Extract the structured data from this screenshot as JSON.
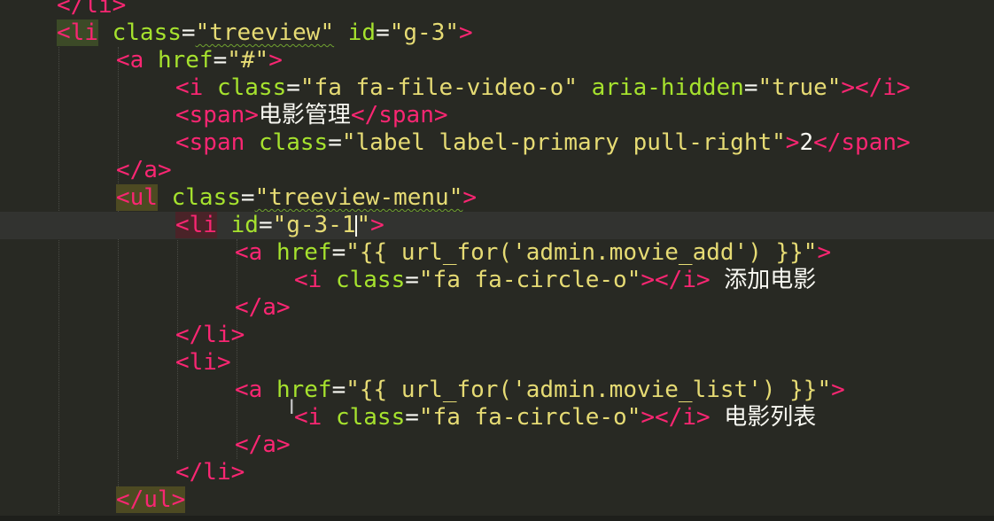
{
  "editor": {
    "lines": [
      {
        "id": "l0",
        "indent": 1,
        "parts": [
          [
            "tag",
            "</li>"
          ]
        ]
      },
      {
        "id": "l1",
        "indent": 1,
        "parts": [
          [
            "tag",
            "<li"
          ],
          [
            "punc",
            " "
          ],
          [
            "attr",
            "class"
          ],
          [
            "punc",
            "="
          ],
          [
            "str",
            "\"treeview\""
          ],
          [
            "punc",
            " "
          ],
          [
            "attr",
            "id"
          ],
          [
            "punc",
            "="
          ],
          [
            "str",
            "\"g-3\""
          ],
          [
            "tag",
            ">"
          ]
        ]
      },
      {
        "id": "l2",
        "indent": 2,
        "parts": [
          [
            "tag",
            "<a"
          ],
          [
            "punc",
            " "
          ],
          [
            "attr",
            "href"
          ],
          [
            "punc",
            "="
          ],
          [
            "str",
            "\"#\""
          ],
          [
            "tag",
            ">"
          ]
        ]
      },
      {
        "id": "l3",
        "indent": 3,
        "parts": [
          [
            "tag",
            "<i"
          ],
          [
            "punc",
            " "
          ],
          [
            "attr",
            "class"
          ],
          [
            "punc",
            "="
          ],
          [
            "str",
            "\"fa fa-file-video-o\""
          ],
          [
            "punc",
            " "
          ],
          [
            "attr",
            "aria-hidden"
          ],
          [
            "punc",
            "="
          ],
          [
            "str",
            "\"true\""
          ],
          [
            "tag",
            "></i>"
          ]
        ]
      },
      {
        "id": "l4",
        "indent": 3,
        "parts": [
          [
            "tag",
            "<span>"
          ],
          [
            "text",
            "电影管理"
          ],
          [
            "tag",
            "</span>"
          ]
        ]
      },
      {
        "id": "l5",
        "indent": 3,
        "parts": [
          [
            "tag",
            "<span"
          ],
          [
            "punc",
            " "
          ],
          [
            "attr",
            "class"
          ],
          [
            "punc",
            "="
          ],
          [
            "str",
            "\"label label-primary pull-right\""
          ],
          [
            "tag",
            ">"
          ],
          [
            "text",
            "2"
          ],
          [
            "tag",
            "</span>"
          ]
        ]
      },
      {
        "id": "l6",
        "indent": 2,
        "parts": [
          [
            "tag",
            "</a>"
          ]
        ]
      },
      {
        "id": "l7",
        "indent": 2,
        "parts": [
          [
            "tag",
            "<ul"
          ],
          [
            "punc",
            " "
          ],
          [
            "attr",
            "class"
          ],
          [
            "punc",
            "="
          ],
          [
            "str",
            "\"treeview-menu\""
          ],
          [
            "tag",
            ">"
          ]
        ]
      },
      {
        "id": "l8",
        "indent": 3,
        "parts": [
          [
            "tag",
            "<li"
          ],
          [
            "punc",
            " "
          ],
          [
            "attr",
            "id"
          ],
          [
            "punc",
            "="
          ],
          [
            "str",
            "\"g-3-1"
          ],
          [
            "caret",
            ""
          ],
          [
            "str",
            "\""
          ],
          [
            "tag",
            ">"
          ]
        ]
      },
      {
        "id": "l9",
        "indent": 4,
        "parts": [
          [
            "tag",
            "<a"
          ],
          [
            "punc",
            " "
          ],
          [
            "attr",
            "href"
          ],
          [
            "punc",
            "="
          ],
          [
            "str",
            "\"{{ url_for('admin.movie_add') }}\""
          ],
          [
            "tag",
            ">"
          ]
        ]
      },
      {
        "id": "l10",
        "indent": 5,
        "parts": [
          [
            "tag",
            "<i"
          ],
          [
            "punc",
            " "
          ],
          [
            "attr",
            "class"
          ],
          [
            "punc",
            "="
          ],
          [
            "str",
            "\"fa fa-circle-o\""
          ],
          [
            "tag",
            "></i>"
          ],
          [
            "text",
            " 添加电影"
          ]
        ]
      },
      {
        "id": "l11",
        "indent": 4,
        "parts": [
          [
            "tag",
            "</a>"
          ]
        ]
      },
      {
        "id": "l12",
        "indent": 3,
        "parts": [
          [
            "tag",
            "</li>"
          ]
        ]
      },
      {
        "id": "l13",
        "indent": 3,
        "parts": [
          [
            "tag",
            "<li>"
          ]
        ]
      },
      {
        "id": "l14",
        "indent": 4,
        "parts": [
          [
            "tag",
            "<a"
          ],
          [
            "punc",
            " "
          ],
          [
            "attr",
            "href"
          ],
          [
            "punc",
            "="
          ],
          [
            "str",
            "\"{{ url_for('admin.movie_list') }}\""
          ],
          [
            "tag",
            ">"
          ]
        ]
      },
      {
        "id": "l15",
        "indent": 5,
        "parts": [
          [
            "tag",
            "<i"
          ],
          [
            "punc",
            " "
          ],
          [
            "attr",
            "class"
          ],
          [
            "punc",
            "="
          ],
          [
            "str",
            "\"fa fa-circle-o\""
          ],
          [
            "tag",
            "></i>"
          ],
          [
            "text",
            " 电影列表"
          ]
        ]
      },
      {
        "id": "l16",
        "indent": 4,
        "parts": [
          [
            "tag",
            "</a>"
          ]
        ]
      },
      {
        "id": "l17",
        "indent": 3,
        "parts": [
          [
            "tag",
            "</li>"
          ]
        ]
      },
      {
        "id": "l18",
        "indent": 2,
        "parts": [
          [
            "tag",
            "</ul>"
          ]
        ]
      }
    ]
  },
  "colors": {
    "background": "#282923",
    "tag": "#f92672",
    "attribute": "#a6e22e",
    "string": "#e6db74",
    "text": "#f8f8f2"
  }
}
